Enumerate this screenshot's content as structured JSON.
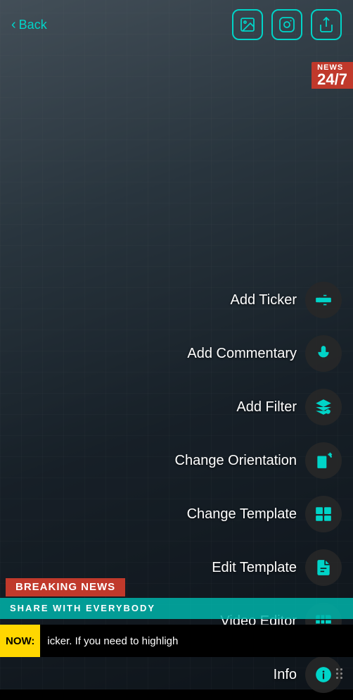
{
  "header": {
    "back_label": "Back",
    "icons": [
      {
        "name": "image-icon",
        "label": "Gallery"
      },
      {
        "name": "instagram-icon",
        "label": "Instagram"
      },
      {
        "name": "share-icon",
        "label": "Share"
      }
    ]
  },
  "news_badge": {
    "top_text": "NEWS",
    "number_text": "24/7"
  },
  "menu": {
    "items": [
      {
        "id": "add-ticker",
        "label": "Add Ticker",
        "icon": "ticker-icon"
      },
      {
        "id": "add-commentary",
        "label": "Add Commentary",
        "icon": "microphone-icon"
      },
      {
        "id": "add-filter",
        "label": "Add Filter",
        "icon": "filter-icon"
      },
      {
        "id": "change-orientation",
        "label": "Change Orientation",
        "icon": "orientation-icon"
      },
      {
        "id": "change-template",
        "label": "Change Template",
        "icon": "template-icon"
      },
      {
        "id": "edit-template",
        "label": "Edit Template",
        "icon": "edit-template-icon"
      },
      {
        "id": "video-editor",
        "label": "Video Editor",
        "icon": "video-icon"
      },
      {
        "id": "info",
        "label": "Info",
        "icon": "info-icon"
      }
    ]
  },
  "breaking_news": {
    "title": "BREAKING NEWS",
    "subtitle": "SHARE WITH EVERYBODY"
  },
  "ticker": {
    "now_label": "NOW:",
    "text": "icker. If you need to highligh"
  },
  "accent_color": "#00d4c8"
}
